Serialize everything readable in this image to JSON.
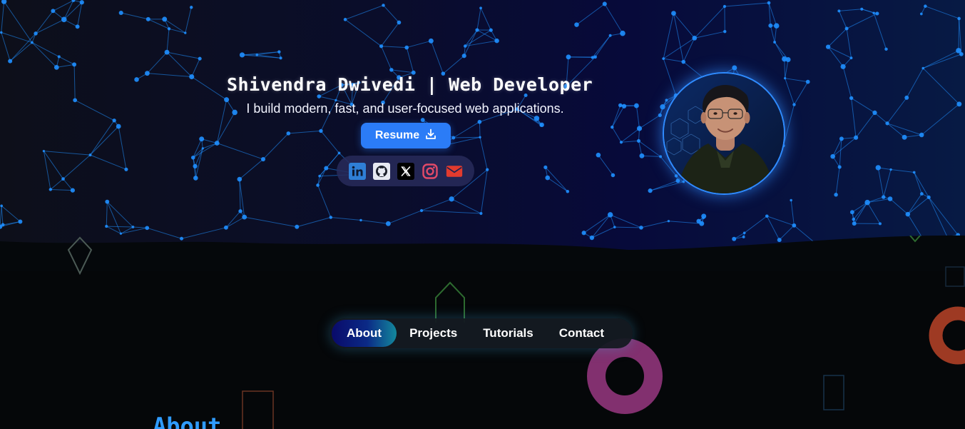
{
  "hero": {
    "title": "Shivendra Dwivedi | Web Developer",
    "subtitle": "I build modern, fast, and user-focused web applications.",
    "resume_label": "Resume",
    "resume_icon": "download-icon",
    "avatar_alt": "profile-photo"
  },
  "social": [
    {
      "name": "linkedin-icon",
      "color": "#2f7fd6"
    },
    {
      "name": "github-icon",
      "color": "#e6e9f2"
    },
    {
      "name": "x-twitter-icon",
      "color": "#000000"
    },
    {
      "name": "instagram-icon",
      "color": "#e24a68"
    },
    {
      "name": "email-icon",
      "color": "#e23b2e"
    }
  ],
  "nav": {
    "items": [
      {
        "label": "About",
        "active": true
      },
      {
        "label": "Projects",
        "active": false
      },
      {
        "label": "Tutorials",
        "active": false
      },
      {
        "label": "Contact",
        "active": false
      }
    ]
  },
  "about": {
    "heading": "About"
  },
  "colors": {
    "accent": "#2b7cf7",
    "network": "#1f8fff",
    "ring_magenta": "#8a2c78",
    "ring_orange": "#9e3a23"
  }
}
